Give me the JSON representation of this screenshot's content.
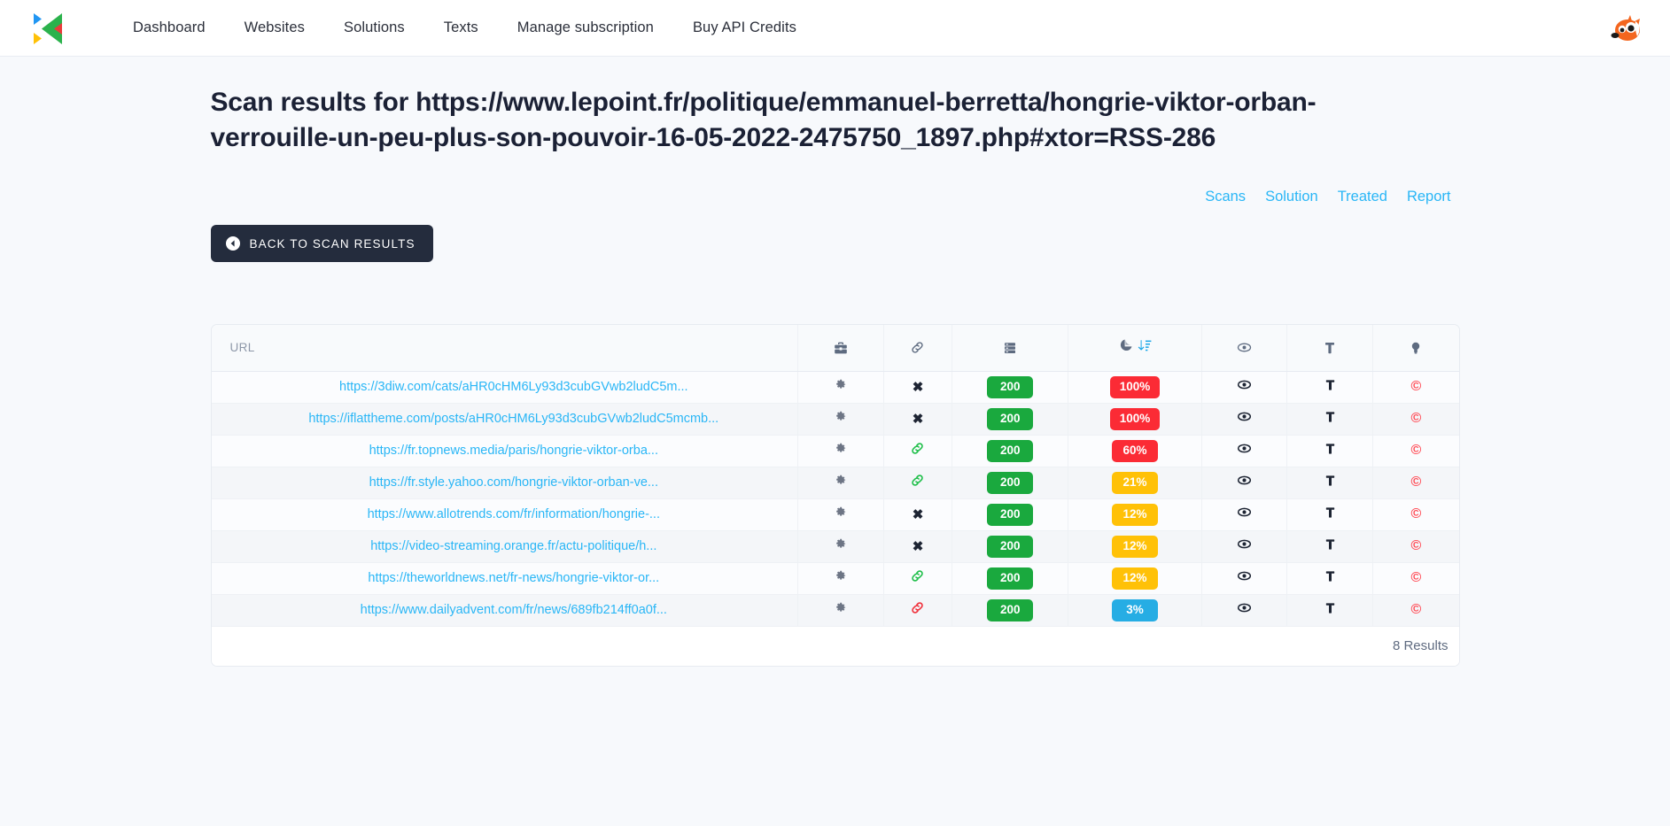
{
  "nav": {
    "logo_name": "kleap-logo",
    "items": [
      {
        "label": "Dashboard"
      },
      {
        "label": "Websites"
      },
      {
        "label": "Solutions"
      },
      {
        "label": "Texts"
      },
      {
        "label": "Manage subscription"
      },
      {
        "label": "Buy API Credits"
      }
    ],
    "avatar_name": "fox-avatar"
  },
  "header": {
    "title": "Scan results for https://www.lepoint.fr/politique/emmanuel-berretta/hongrie-viktor-orban-verrouille-un-peu-plus-son-pouvoir-16-05-2022-2475750_1897.php#xtor=RSS-286"
  },
  "quicklinks": [
    {
      "label": "Scans"
    },
    {
      "label": "Solution"
    },
    {
      "label": "Treated"
    },
    {
      "label": "Report"
    }
  ],
  "back_button": {
    "label": "BACK TO SCAN RESULTS"
  },
  "table": {
    "columns": [
      {
        "key": "url",
        "label": "URL",
        "icon": null
      },
      {
        "key": "tools",
        "label": "",
        "icon": "toolbox-icon"
      },
      {
        "key": "link",
        "label": "",
        "icon": "link-icon"
      },
      {
        "key": "status",
        "label": "",
        "icon": "server-icon"
      },
      {
        "key": "match",
        "label": "",
        "icon": "pie-chart-icon",
        "sort_icon": "sort-descending-icon",
        "sorted": true
      },
      {
        "key": "view",
        "label": "",
        "icon": "eye-icon"
      },
      {
        "key": "legal",
        "label": "",
        "icon": "hammer-icon"
      },
      {
        "key": "idea",
        "label": "",
        "icon": "lightbulb-icon"
      }
    ],
    "rows": [
      {
        "url": "https://3diw.com/cats/aHR0cHM6Ly93d3cubGVwb2ludC5m...",
        "tools_icon": "gear-icon",
        "link_icon": "x-icon",
        "link_state": "none",
        "status": "200",
        "status_color": "#1aa93e",
        "match": "100%",
        "match_color": "#fb2b35",
        "view_icon": "eye-icon",
        "legal_icon": "hammer-icon",
        "idea_icon": "copyright-icon"
      },
      {
        "url": "https://iflattheme.com/posts/aHR0cHM6Ly93d3cubGVwb2ludC5mcmb...",
        "tools_icon": "gear-icon",
        "link_icon": "x-icon",
        "link_state": "none",
        "status": "200",
        "status_color": "#1aa93e",
        "match": "100%",
        "match_color": "#fb2b35",
        "view_icon": "eye-icon",
        "legal_icon": "hammer-icon",
        "idea_icon": "copyright-icon"
      },
      {
        "url": "https://fr.topnews.media/paris/hongrie-viktor-orba...",
        "tools_icon": "gear-icon",
        "link_icon": "link-icon",
        "link_state": "green",
        "status": "200",
        "status_color": "#1aa93e",
        "match": "60%",
        "match_color": "#fb2b35",
        "view_icon": "eye-icon",
        "legal_icon": "hammer-icon",
        "idea_icon": "copyright-icon"
      },
      {
        "url": "https://fr.style.yahoo.com/hongrie-viktor-orban-ve...",
        "tools_icon": "gear-icon",
        "link_icon": "link-icon",
        "link_state": "green",
        "status": "200",
        "status_color": "#1aa93e",
        "match": "21%",
        "match_color": "#ffc107",
        "view_icon": "eye-icon",
        "legal_icon": "hammer-icon",
        "idea_icon": "copyright-icon"
      },
      {
        "url": "https://www.allotrends.com/fr/information/hongrie-...",
        "tools_icon": "gear-icon",
        "link_icon": "x-icon",
        "link_state": "none",
        "status": "200",
        "status_color": "#1aa93e",
        "match": "12%",
        "match_color": "#ffc107",
        "view_icon": "eye-icon",
        "legal_icon": "hammer-icon",
        "idea_icon": "copyright-icon"
      },
      {
        "url": "https://video-streaming.orange.fr/actu-politique/h...",
        "tools_icon": "gear-icon",
        "link_icon": "x-icon",
        "link_state": "none",
        "status": "200",
        "status_color": "#1aa93e",
        "match": "12%",
        "match_color": "#ffc107",
        "view_icon": "eye-icon",
        "legal_icon": "hammer-icon",
        "idea_icon": "copyright-icon"
      },
      {
        "url": "https://theworldnews.net/fr-news/hongrie-viktor-or...",
        "tools_icon": "gear-icon",
        "link_icon": "link-icon",
        "link_state": "green",
        "status": "200",
        "status_color": "#1aa93e",
        "match": "12%",
        "match_color": "#ffc107",
        "view_icon": "eye-icon",
        "legal_icon": "hammer-icon",
        "idea_icon": "copyright-icon"
      },
      {
        "url": "https://www.dailyadvent.com/fr/news/689fb214ff0a0f...",
        "tools_icon": "gear-icon",
        "link_icon": "link-icon",
        "link_state": "red",
        "status": "200",
        "status_color": "#1aa93e",
        "match": "3%",
        "match_color": "#26ade4",
        "view_icon": "eye-icon",
        "legal_icon": "hammer-icon",
        "idea_icon": "copyright-icon"
      }
    ],
    "footer": {
      "results_label": "8 Results"
    }
  },
  "colors": {
    "accent_blue": "#29b6f6",
    "dark_navy": "#242c3d",
    "green": "#1aa93e",
    "red": "#fb2b35",
    "amber": "#ffc107",
    "light_blue": "#26ade4",
    "page_bg": "#f7f9fc"
  }
}
